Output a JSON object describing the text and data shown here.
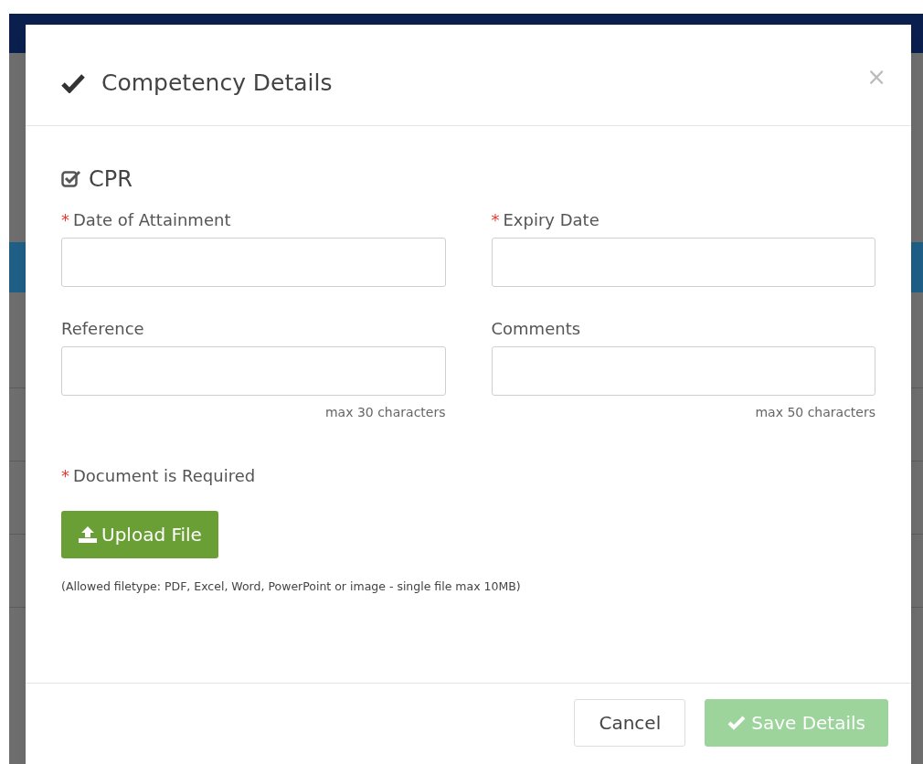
{
  "dialog": {
    "title": "Competency Details",
    "close": "×"
  },
  "competency": {
    "label": "CPR",
    "checked": true
  },
  "fields": [
    {
      "label": "Date of Attainment",
      "required_mark": "*"
    },
    {
      "label": "Expiry Date",
      "required_mark": "*"
    },
    {
      "label": "Reference",
      "hint": "max 30 characters"
    },
    {
      "label": "Comments",
      "hint": "max 50 characters"
    }
  ],
  "document": {
    "label": "Document is Required",
    "required_mark": "*"
  },
  "upload_button": "Upload File",
  "allowed_note": "(Allowed filetype: PDF, Excel, Word, PowerPoint or image - single file max 10MB)",
  "buttons": [
    {
      "label": "Cancel",
      "kind": "cancel",
      "disabled": false
    },
    {
      "label": "Save Details",
      "kind": "save",
      "disabled": true
    }
  ]
}
